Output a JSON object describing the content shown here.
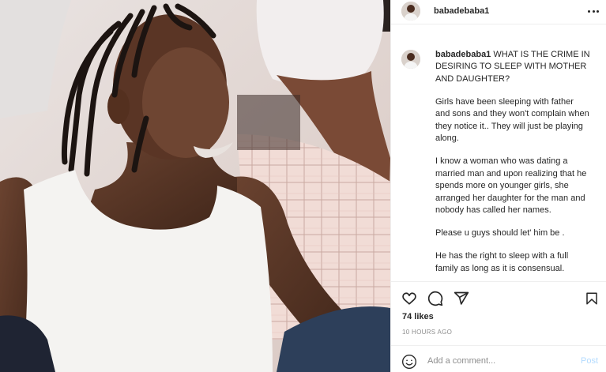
{
  "header": {
    "username": "babadebaba1",
    "more_icon": "more-options-icon"
  },
  "caption": {
    "username": "babadebaba1",
    "title": "WHAT IS THE CRIME IN DESIRING TO SLEEP WITH MOTHER AND DAUGHTER?",
    "paragraphs": [
      "Girls have been sleeping with father and sons and they won't complain when they notice it.. They will just be playing along.",
      "I know a woman who was dating a married man and upon realizing that he spends more on younger girls, she arranged her daughter for the man and nobody has called her names.",
      "Please u guys should let' him be .",
      "He has the right to sleep with a full family as long as it is consensual."
    ]
  },
  "actions": {
    "icons": [
      "heart-icon",
      "comment-icon",
      "share-icon",
      "bookmark-icon"
    ]
  },
  "likes": "74 likes",
  "timestamp": "10 HOURS AGO",
  "comment_box": {
    "emoji_icon": "emoji-icon",
    "placeholder": "Add a comment...",
    "post_label": "Post"
  },
  "colors": {
    "text": "#262626",
    "secondary": "#8e8e8e",
    "border": "#efefef",
    "post_button": "#b3dbff"
  }
}
